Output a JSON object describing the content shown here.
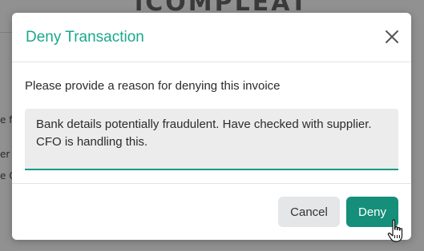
{
  "background": {
    "logo_text": "iCOMPLEAT",
    "fragments": [
      "e fo",
      "er",
      "e C"
    ]
  },
  "modal": {
    "title": "Deny Transaction",
    "prompt": "Please provide a reason for denying this invoice",
    "reason_value": "Bank details potentially fraudulent. Have checked with supplier. CFO is handling this.",
    "cancel_label": "Cancel",
    "deny_label": "Deny"
  },
  "icons": {
    "close": "close-icon",
    "cursor": "hand-pointer-icon"
  },
  "colors": {
    "accent": "#1aa88e",
    "deny_button": "#168f7a",
    "cancel_button": "#e4e6e8",
    "field_bg": "#ececec",
    "overlay": "#919191"
  }
}
